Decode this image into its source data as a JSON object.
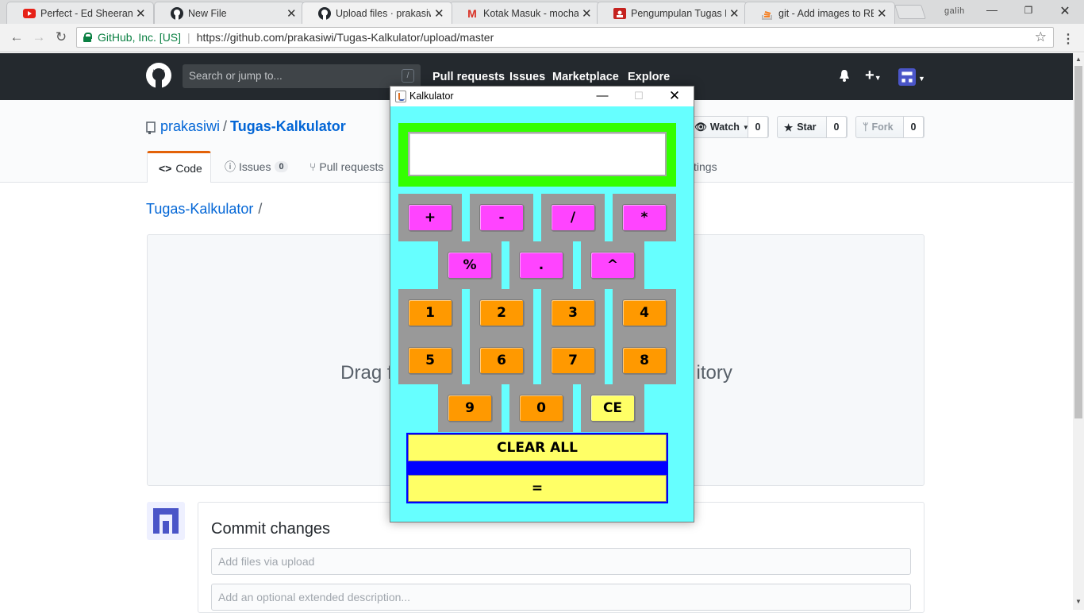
{
  "browser": {
    "tabs": [
      {
        "title": "Perfect - Ed Sheeran (Ly",
        "icon": "youtube-icon"
      },
      {
        "title": "New File",
        "icon": "github-icon"
      },
      {
        "title": "Upload files · prakasiwi/",
        "icon": "github-icon",
        "active": true
      },
      {
        "title": "Kotak Masuk - mocham",
        "icon": "gmail-icon"
      },
      {
        "title": "Pengumpulan Tugas Ha",
        "icon": "classroom-icon"
      },
      {
        "title": "git - Add images to REA",
        "icon": "stackoverflow-icon"
      }
    ],
    "profile": "galih",
    "address": {
      "org": "GitHub, Inc. [US]",
      "url": "https://github.com/prakasiwi/Tugas-Kalkulator/upload/master"
    }
  },
  "github": {
    "search_placeholder": "Search or jump to...",
    "search_key": "/",
    "nav": [
      "Pull requests",
      "Issues",
      "Marketplace",
      "Explore"
    ],
    "repo_owner": "prakasiwi",
    "repo_name": "Tugas-Kalkulator",
    "watch_label": "Watch",
    "watch_count": "0",
    "star_label": "Star",
    "star_count": "0",
    "fork_label": "Fork",
    "fork_count": "0",
    "tabs": {
      "code": "Code",
      "issues": "Issues",
      "issues_count": "0",
      "pulls": "Pull requests",
      "settings_partial": "tings"
    },
    "breadcrumb": "Tugas-Kalkulator",
    "breadcrumb_sep": "/",
    "drag_left": "Drag f",
    "drag_right": "itory",
    "commit_title": "Commit changes",
    "commit_summary_placeholder": "Add files via upload",
    "commit_desc_placeholder": "Add an optional extended description..."
  },
  "calculator": {
    "title": "Kalkulator",
    "display_value": "",
    "ops_row1": [
      "+",
      "-",
      "/",
      "*"
    ],
    "ops_row2": [
      "%",
      ".",
      "^"
    ],
    "nums_row1": [
      "1",
      "2",
      "3",
      "4"
    ],
    "nums_row2": [
      "5",
      "6",
      "7",
      "8"
    ],
    "nums_row3": [
      "9",
      "0"
    ],
    "ce": "CE",
    "clear_all": "CLEAR ALL",
    "equals": "=",
    "colors": {
      "bg": "#66ffff",
      "display_frame": "#33ff00",
      "op": "#ff44ff",
      "num": "#ff9900",
      "ce": "#ffff66",
      "panel": "#0000ff",
      "grey": "#999999"
    }
  }
}
